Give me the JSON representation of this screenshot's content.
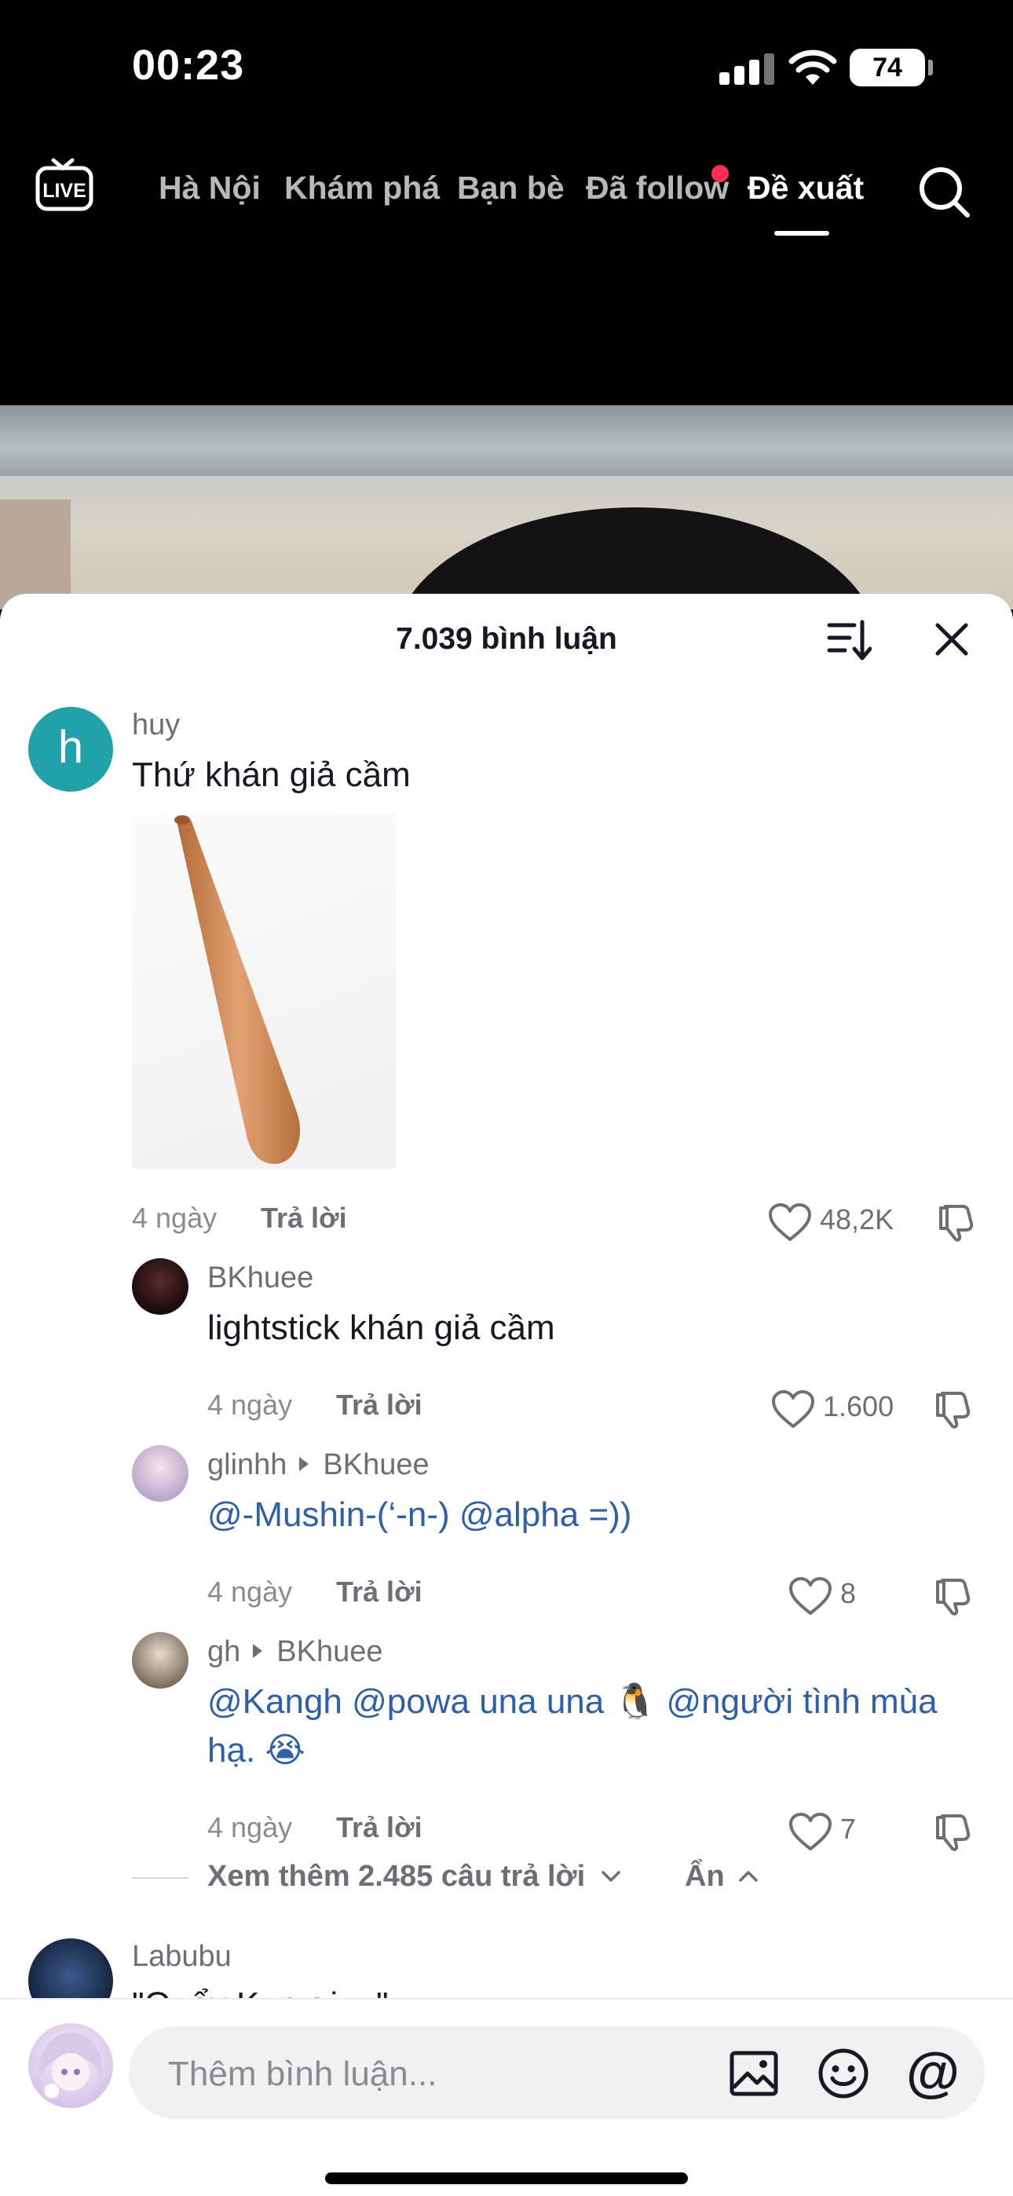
{
  "status_bar": {
    "time": "00:23",
    "battery": "74"
  },
  "nav": {
    "live_label": "LIVE",
    "tabs": [
      "Hà Nội",
      "Khám phá",
      "Bạn bè",
      "Đã follow",
      "Đề xuất"
    ],
    "active_tab": "Đề xuất"
  },
  "comments_sheet": {
    "title": "7.039 bình luận",
    "comments": [
      {
        "username": "huy",
        "avatar_letter": "h",
        "text": "Thứ khán giả cầm",
        "date": "4 ngày",
        "reply_label": "Trả lời",
        "likes": "48,2K"
      }
    ],
    "replies": [
      {
        "username": "BKhuee",
        "reply_to": "",
        "text": "lightstick khán giả cầm",
        "date": "4 ngày",
        "reply_label": "Trả lời",
        "likes": "1.600"
      },
      {
        "username": "glinhh",
        "reply_to": "BKhuee",
        "text": "@-Mushin-(‘-n-) @alpha =))",
        "date": "4 ngày",
        "reply_label": "Trả lời",
        "likes": "8"
      },
      {
        "username": "gh",
        "reply_to": "BKhuee",
        "text": "@Kangh @powa una una 🐧 @người tình mùa hạ. 😭",
        "date": "4 ngày",
        "reply_label": "Trả lời",
        "likes": "7"
      }
    ],
    "view_more": "Xem thêm 2.485 câu trả lời",
    "hide_label": "Ẩn",
    "next_comment": {
      "username": "Labubu",
      "text_partial": "\"Quẩy Kun ơi ...\""
    }
  },
  "input": {
    "placeholder": "Thêm bình luận..."
  },
  "colors": {
    "accent": "#fe2c55",
    "mention": "#2f5fa8",
    "avatar_h": "#20a2a8"
  }
}
